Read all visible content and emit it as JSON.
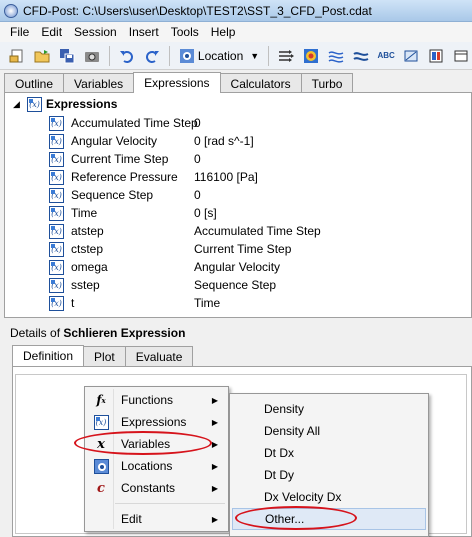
{
  "window": {
    "title": "CFD-Post: C:\\Users\\user\\Desktop\\TEST2\\SST_3_CFD_Post.cdat"
  },
  "menubar": [
    "File",
    "Edit",
    "Session",
    "Insert",
    "Tools",
    "Help"
  ],
  "toolbar": {
    "icons": [
      "open-file-icon",
      "open-folder-icon",
      "save-icon",
      "snapshot-icon",
      "undo-icon",
      "redo-icon",
      "location-icon",
      "vector-icon",
      "contour-icon",
      "streamline-icon",
      "volume-icon",
      "text-icon",
      "clip-icon",
      "color-map-icon",
      "box-icon"
    ],
    "location_label": "Location",
    "text_icon_label": "ABC"
  },
  "top_tabs": [
    "Outline",
    "Variables",
    "Expressions",
    "Calculators",
    "Turbo"
  ],
  "active_top_tab": "Expressions",
  "tree": {
    "root_label": "Expressions",
    "rows": [
      {
        "name": "Accumulated Time Step",
        "value": "0"
      },
      {
        "name": "Angular Velocity",
        "value": "0 [rad s^-1]"
      },
      {
        "name": "Current Time Step",
        "value": "0"
      },
      {
        "name": "Reference Pressure",
        "value": "116100 [Pa]"
      },
      {
        "name": "Sequence Step",
        "value": "0"
      },
      {
        "name": "Time",
        "value": "0 [s]"
      },
      {
        "name": "atstep",
        "value": "Accumulated Time Step"
      },
      {
        "name": "ctstep",
        "value": "Current Time Step"
      },
      {
        "name": "omega",
        "value": "Angular Velocity"
      },
      {
        "name": "sstep",
        "value": "Sequence Step"
      },
      {
        "name": "t",
        "value": "Time"
      }
    ]
  },
  "details": {
    "prefix": "Details of ",
    "object_name": "Schlieren Expression",
    "tabs": [
      "Definition",
      "Plot",
      "Evaluate"
    ],
    "active_tab": "Definition"
  },
  "context_menu": {
    "items": [
      {
        "label": "Functions",
        "icon": "function-icon",
        "icon_text": "f",
        "icon_sub": "x",
        "has_submenu": true
      },
      {
        "label": "Expressions",
        "icon": "expression-icon",
        "icon_text": "",
        "icon_sub": "",
        "has_submenu": true
      },
      {
        "label": "Variables",
        "icon": "variable-icon",
        "icon_text": "x",
        "icon_sub": "",
        "has_submenu": true
      },
      {
        "label": "Locations",
        "icon": "location-icon",
        "icon_text": "",
        "icon_sub": "",
        "has_submenu": true
      },
      {
        "label": "Constants",
        "icon": "constant-icon",
        "icon_text": "c",
        "icon_sub": "",
        "has_submenu": true
      },
      {
        "label": "Edit",
        "icon": "",
        "icon_text": "",
        "icon_sub": "",
        "has_submenu": true
      }
    ],
    "submenu_arrow": "▶"
  },
  "variables_submenu": {
    "items": [
      "Density",
      "Density All",
      "Dt Dx",
      "Dt Dy",
      "Dx Velocity Dx",
      "Other..."
    ],
    "highlighted": "Other..."
  },
  "colors": {
    "annotation_oval": "#d6131b",
    "accent": "#1e4f9a"
  }
}
